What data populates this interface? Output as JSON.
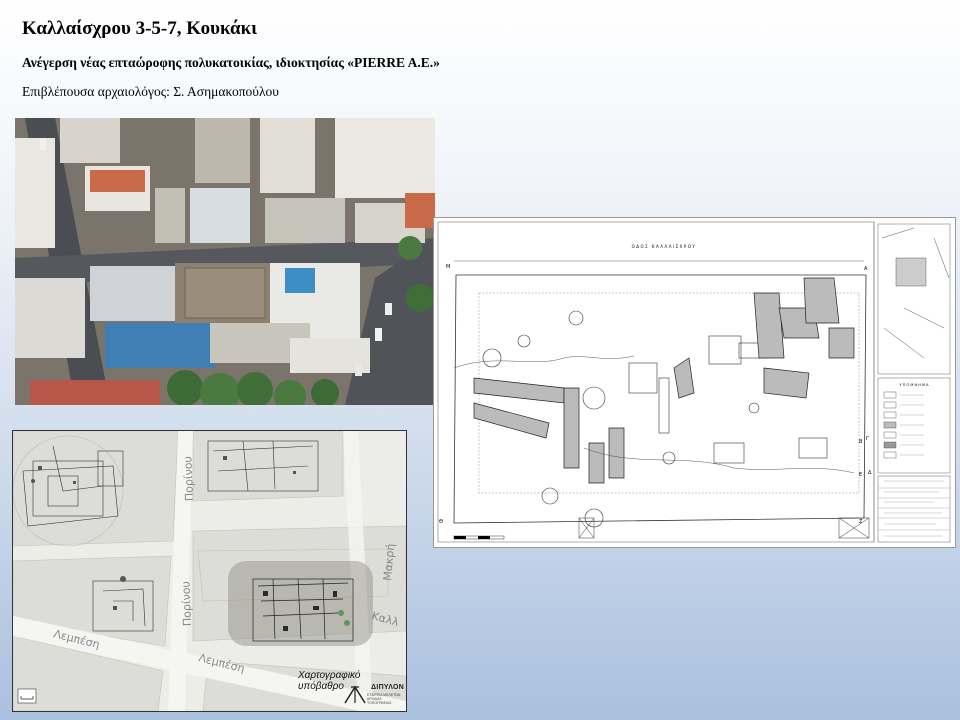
{
  "slide": {
    "title": "Καλλαίσχρου 3-5-7, Κουκάκι",
    "subtitle": "Ανέγερση νέας επταώροφης πολυκατοικίας, ιδιοκτησίας «PIERRE A.E.»",
    "supervisor": "Επιβλέπουσα αρχαιολόγος: Σ. Ασημακοπούλου"
  },
  "map_panel": {
    "caption": "Χαρτογραφικό υπόβαθρο",
    "logo_name": "ΔΙΠΥΛΟΝ",
    "logo_subtitle": "ΕΤΑΙΡΕΙΑ ΜΕΛΕΤΩΝ ΑΡΧΑΙΑΣ ΤΟΠΟΓΡΑΦΙΑΣ",
    "streets": [
      "Πορίνου",
      "Καλλ",
      "Λεμπέση",
      "Λεμπέση",
      "Μακρή"
    ]
  },
  "plan_panel": {
    "street_label": "ΟΔΟΣ ΚΑΛΛΑΙΣΧΡΟΥ",
    "corner_labels": [
      "Μ",
      "Α",
      "Θ",
      "Ζ",
      "Β",
      "Γ",
      "Ε",
      "Δ"
    ],
    "legend_title": "Υ Π Ο Μ Ν Η Μ Α"
  },
  "colors": {
    "background_top": "#ffffff",
    "background_bottom": "#a9c0de"
  }
}
